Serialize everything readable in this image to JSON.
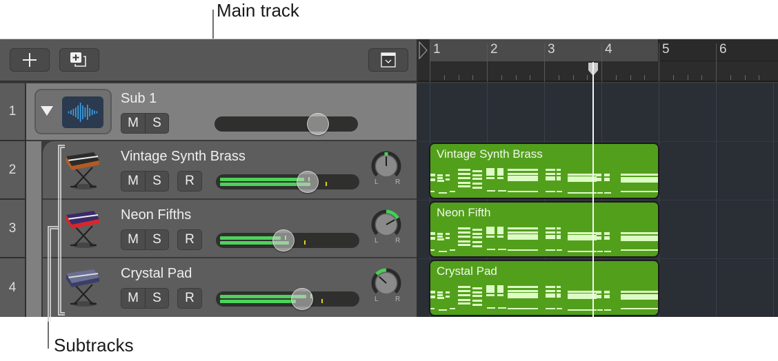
{
  "callouts": {
    "main_track": "Main track",
    "subtracks": "Subtracks"
  },
  "toolbar": {
    "add_track_icon": "plus-icon",
    "add_track_stack_icon": "add-stack-icon",
    "view_menu_icon": "chevron-down-box-icon"
  },
  "ruler": {
    "bars": [
      "1",
      "2",
      "3",
      "4",
      "5",
      "6"
    ],
    "cycle_range": [
      1,
      5
    ],
    "playhead_bar": 3.85
  },
  "tracks": {
    "main": {
      "number": "1",
      "name": "Sub 1",
      "mute": "M",
      "solo": "S",
      "volume": 0.72,
      "icon": "waveform-icon"
    },
    "subtracks": [
      {
        "number": "2",
        "name": "Vintage Synth Brass",
        "mute": "M",
        "solo": "S",
        "record": "R",
        "volume": 0.64,
        "meter_levels": [
          0.62,
          0.67
        ],
        "pan": 0.0,
        "instrument": "orange-synth",
        "region_name": "Vintage Synth Brass"
      },
      {
        "number": "3",
        "name": "Neon Fifths",
        "mute": "M",
        "solo": "S",
        "record": "R",
        "volume": 0.47,
        "meter_levels": [
          0.45,
          0.51
        ],
        "pan": 0.45,
        "instrument": "red-keyboard",
        "region_name": "Neon Fifth"
      },
      {
        "number": "4",
        "name": "Crystal Pad",
        "mute": "M",
        "solo": "S",
        "record": "R",
        "volume": 0.6,
        "meter_levels": [
          0.64,
          0.56
        ],
        "pan": -0.35,
        "instrument": "blue-workstation",
        "region_name": "Crystal Pad"
      }
    ]
  },
  "pan_labels": {
    "left": "L",
    "right": "R"
  },
  "colors": {
    "region": "#529f1c",
    "meter": "#4ed25a",
    "peak": "#e3d31a",
    "waveform": "#3ea3ec"
  }
}
